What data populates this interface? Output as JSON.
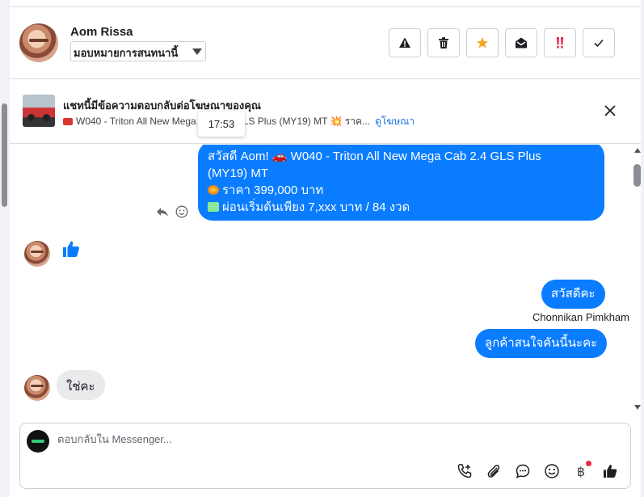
{
  "header": {
    "contact_name": "Aom Rissa",
    "assign_label": "มอบหมายการสนทนานี้",
    "actions": [
      {
        "name": "report-spam-button",
        "icon": "warning-icon"
      },
      {
        "name": "delete-button",
        "icon": "trash-icon"
      },
      {
        "name": "star-button",
        "icon": "star-icon"
      },
      {
        "name": "mark-unread-button",
        "icon": "envelope-open-icon"
      },
      {
        "name": "follow-up-button",
        "icon": "exclamation-icon"
      },
      {
        "name": "mark-done-button",
        "icon": "check-icon"
      }
    ]
  },
  "ad": {
    "title": "แชทนี้มีข้อความตอบกลับต่อโฆษณาของคุณ",
    "description": "W040 - Triton All New Mega Cab 2.4 GLS Plus (MY19) MT 💥 ราค...",
    "link_label": "ดูโฆษณา"
  },
  "tooltip": {
    "time": "17:53"
  },
  "messages": {
    "first": {
      "line1": "สวัสดี Aom! 🚗 W040 - Triton All New Mega Cab 2.4 GLS Plus",
      "line2": "(MY19) MT",
      "line3": "ราคา 399,000 บาท",
      "line4": "ผ่อนเริ่มต้นเพียง 7,xxx บาท / 84 งวด"
    },
    "greeting": "สวัสดีคะ",
    "sender_name": "Chonnikan Pimkham",
    "interest": "ลูกค้าสนใจคันนี้นะคะ",
    "customer_reply": "ใช่คะ"
  },
  "composer": {
    "placeholder": "ตอบกลับใน Messenger...",
    "baht_symbol": "฿"
  },
  "colors": {
    "outgoing_bubble": "#0a7cff",
    "incoming_bubble": "#e9eaec",
    "star": "#f5a623",
    "follow_up": "#e41e3f",
    "link": "#1a73e8"
  }
}
